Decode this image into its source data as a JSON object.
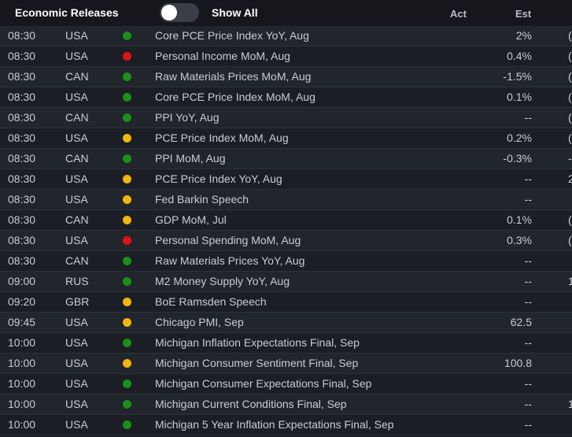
{
  "header": {
    "title": "Economic Releases",
    "toggle_label": "Show All",
    "toggle_on": false,
    "col_act": "Act",
    "col_est": "Est"
  },
  "colors": {
    "green": "#1a8f1a",
    "red": "#e01414",
    "yellow": "#f2b50c"
  },
  "rows": [
    {
      "time": "08:30",
      "country": "USA",
      "importance": "green",
      "name": "Core PCE Price Index YoY, Aug",
      "est": "2%",
      "prev": "("
    },
    {
      "time": "08:30",
      "country": "USA",
      "importance": "red",
      "name": "Personal Income MoM, Aug",
      "est": "0.4%",
      "prev": "("
    },
    {
      "time": "08:30",
      "country": "CAN",
      "importance": "green",
      "name": "Raw Materials Prices MoM, Aug",
      "est": "-1.5%",
      "prev": "("
    },
    {
      "time": "08:30",
      "country": "USA",
      "importance": "green",
      "name": "Core PCE Price Index MoM, Aug",
      "est": "0.1%",
      "prev": "("
    },
    {
      "time": "08:30",
      "country": "CAN",
      "importance": "green",
      "name": "PPI YoY, Aug",
      "est": "--",
      "prev": "("
    },
    {
      "time": "08:30",
      "country": "USA",
      "importance": "yellow",
      "name": "PCE Price Index MoM, Aug",
      "est": "0.2%",
      "prev": "("
    },
    {
      "time": "08:30",
      "country": "CAN",
      "importance": "green",
      "name": "PPI MoM, Aug",
      "est": "-0.3%",
      "prev": "-("
    },
    {
      "time": "08:30",
      "country": "USA",
      "importance": "yellow",
      "name": "PCE Price Index YoY, Aug",
      "est": "--",
      "prev": "2"
    },
    {
      "time": "08:30",
      "country": "USA",
      "importance": "yellow",
      "name": "Fed Barkin Speech",
      "est": "--",
      "prev": ""
    },
    {
      "time": "08:30",
      "country": "CAN",
      "importance": "yellow",
      "name": "GDP MoM, Jul",
      "est": "0.1%",
      "prev": "("
    },
    {
      "time": "08:30",
      "country": "USA",
      "importance": "red",
      "name": "Personal Spending MoM, Aug",
      "est": "0.3%",
      "prev": "("
    },
    {
      "time": "08:30",
      "country": "CAN",
      "importance": "green",
      "name": "Raw Materials Prices YoY, Aug",
      "est": "--",
      "prev": ""
    },
    {
      "time": "09:00",
      "country": "RUS",
      "importance": "green",
      "name": "M2 Money Supply YoY, Aug",
      "est": "--",
      "prev": "1!"
    },
    {
      "time": "09:20",
      "country": "GBR",
      "importance": "yellow",
      "name": "BoE Ramsden Speech",
      "est": "--",
      "prev": ""
    },
    {
      "time": "09:45",
      "country": "USA",
      "importance": "yellow",
      "name": "Chicago PMI, Sep",
      "est": "62.5",
      "prev": ""
    },
    {
      "time": "10:00",
      "country": "USA",
      "importance": "green",
      "name": "Michigan Inflation Expectations Final, Sep",
      "est": "--",
      "prev": ""
    },
    {
      "time": "10:00",
      "country": "USA",
      "importance": "yellow",
      "name": "Michigan Consumer Sentiment Final, Sep",
      "est": "100.8",
      "prev": ""
    },
    {
      "time": "10:00",
      "country": "USA",
      "importance": "green",
      "name": "Michigan Consumer Expectations Final, Sep",
      "est": "--",
      "prev": ""
    },
    {
      "time": "10:00",
      "country": "USA",
      "importance": "green",
      "name": "Michigan Current Conditions Final, Sep",
      "est": "--",
      "prev": "1"
    },
    {
      "time": "10:00",
      "country": "USA",
      "importance": "green",
      "name": "Michigan 5 Year Inflation Expectations Final, Sep",
      "est": "--",
      "prev": ""
    }
  ]
}
